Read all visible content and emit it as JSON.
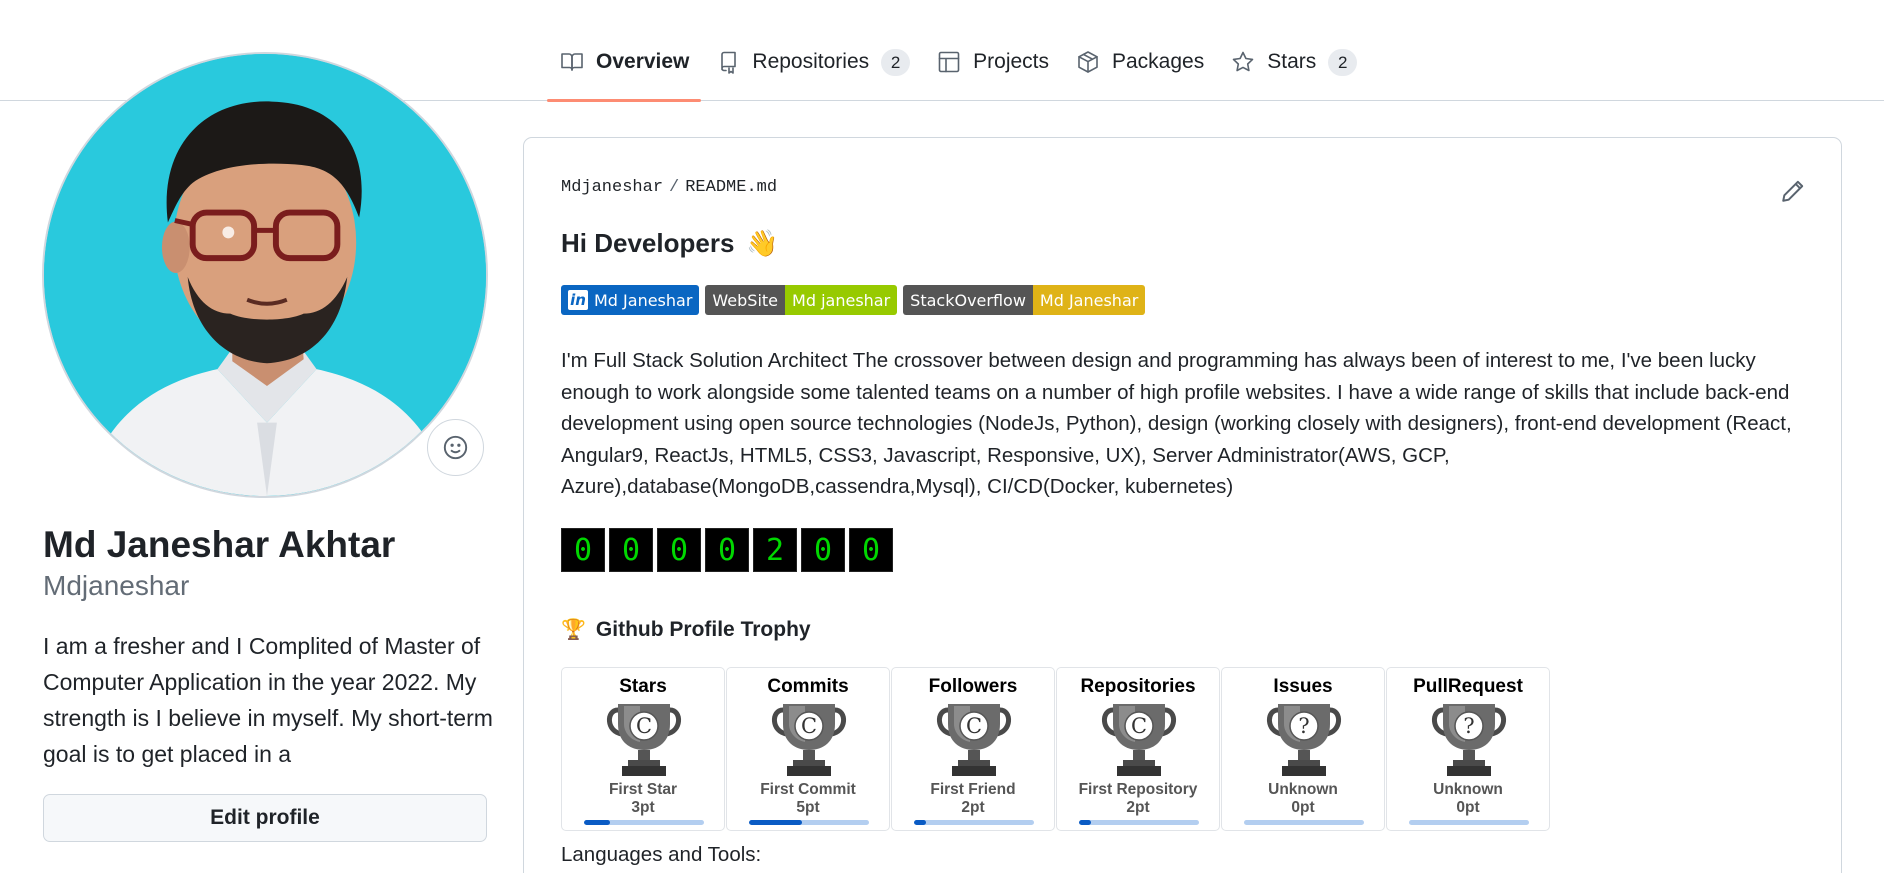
{
  "tabs": [
    {
      "label": "Overview",
      "icon": "book-icon",
      "active": true
    },
    {
      "label": "Repositories",
      "icon": "repo-icon",
      "count": "2"
    },
    {
      "label": "Projects",
      "icon": "table-icon"
    },
    {
      "label": "Packages",
      "icon": "package-icon"
    },
    {
      "label": "Stars",
      "icon": "star-icon",
      "count": "2"
    }
  ],
  "profile": {
    "full_name": "Md Janeshar Akhtar",
    "username": "Mdjaneshar",
    "bio": "I am a fresher and I Complited of Master of Computer Application in the year 2022. My strength is I believe in myself. My short-term goal is to get placed in a",
    "edit_button": "Edit profile",
    "status_icon": "smiley-icon"
  },
  "readme": {
    "owner": "Mdjaneshar",
    "separator": "/",
    "file": "README.md",
    "greeting": "Hi Developers",
    "greeting_emoji": "👋",
    "badges": [
      {
        "left": "Md Janeshar",
        "left_color": "#0a66c2",
        "icon": "linkedin-icon",
        "logo_text": "in"
      },
      {
        "left": "WebSite",
        "right": "Md janeshar",
        "left_color": "#555555",
        "right_color": "#97ca00"
      },
      {
        "left": "StackOverflow",
        "right": "Md Janeshar",
        "left_color": "#555555",
        "right_color": "#dfb317"
      }
    ],
    "description": "I'm Full Stack Solution Architect The crossover between design and programming has always been of interest to me, I've been lucky enough to work alongside some talented teams on a number of high profile websites. I have a wide range of skills that include back-end development using open source technologies (NodeJs, Python), design (working closely with designers), front-end development (React, Angular9, ReactJs, HTML5, CSS3, Javascript, Responsive, UX), Server Administrator(AWS, GCP, Azure),database(MongoDB,cassendra,Mysql), CI/CD(Docker, kubernetes)",
    "visitor_digits": [
      "0",
      "0",
      "0",
      "0",
      "2",
      "0",
      "0"
    ],
    "trophy_heading": "Github Profile Trophy",
    "trophy_heading_icon": "🏆",
    "trophies": [
      {
        "title": "Stars",
        "rank": "C",
        "name": "First Star",
        "points": "3pt",
        "progress": 0.22
      },
      {
        "title": "Commits",
        "rank": "C",
        "name": "First Commit",
        "points": "5pt",
        "progress": 0.44
      },
      {
        "title": "Followers",
        "rank": "C",
        "name": "First Friend",
        "points": "2pt",
        "progress": 0.1
      },
      {
        "title": "Repositories",
        "rank": "C",
        "name": "First Repository",
        "points": "2pt",
        "progress": 0.1
      },
      {
        "title": "Issues",
        "rank": "?",
        "name": "Unknown",
        "points": "0pt",
        "progress": 0
      },
      {
        "title": "PullRequest",
        "rank": "?",
        "name": "Unknown",
        "points": "0pt",
        "progress": 0
      }
    ],
    "languages_heading": "Languages and Tools:"
  },
  "colors": {
    "tab_underline": "#fd8c73",
    "avatar_background": "#29c9dd",
    "counter_digit": "#00d800",
    "trophy_bar_fill": "#0a5bc4",
    "trophy_bar_track": "#b3cef0"
  }
}
